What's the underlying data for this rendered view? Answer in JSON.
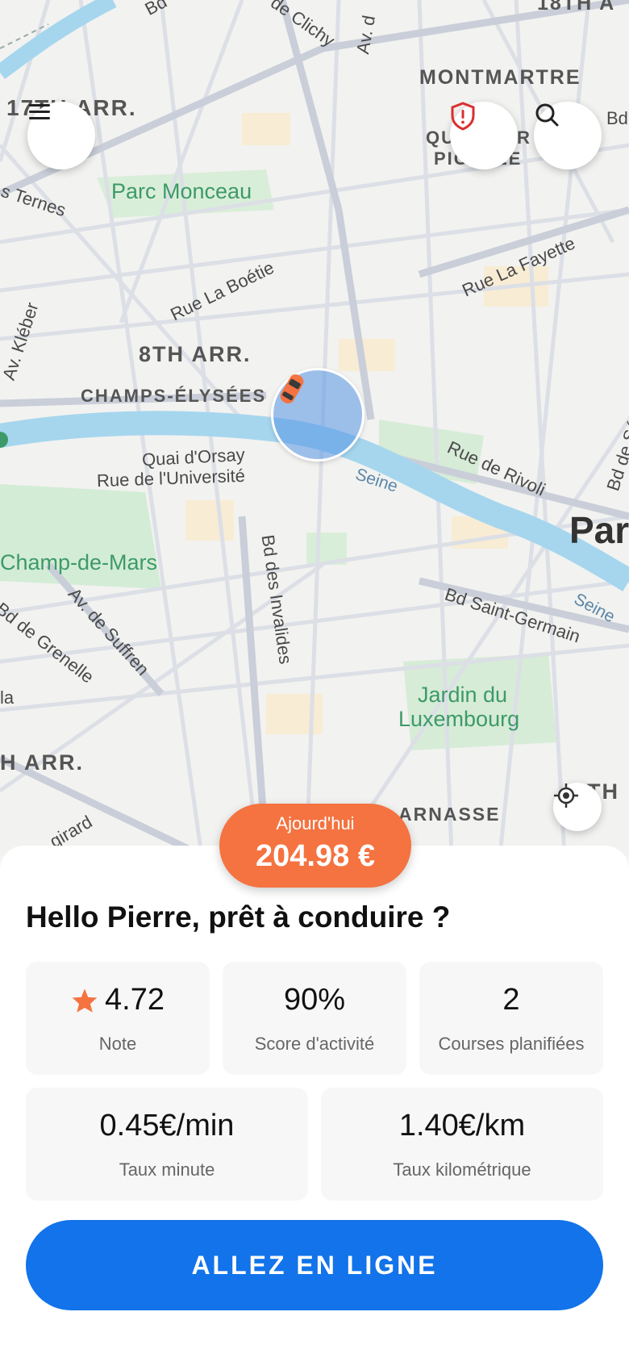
{
  "map": {
    "labels": {
      "bd_top": "Bd",
      "clichy": "de Clichy",
      "av_top": "Av. d",
      "arr18": "18TH A",
      "montmartre": "MONTMARTRE",
      "arr17": "17TH ARR.",
      "quartier": "QUARTIER",
      "pigalle": "PIGALLE",
      "bd_right": "Bd",
      "ternes": "s Ternes",
      "parc_monceau": "Parc Monceau",
      "boetie": "Rue La Boétie",
      "lafayette": "Rue La Fayette",
      "kleber": "Av. Kléber",
      "arr8": "8TH ARR.",
      "champs": "CHAMPS-ÉLYSÉES",
      "quai_orsay": "Quai d'Orsay",
      "universite": "Rue de l'Université",
      "seine1": "Seine",
      "rivoli": "Rue de Rivoli",
      "bd_seba": "Bd de Séba",
      "paris": "Par",
      "champ_mars": "Champ-de-Mars",
      "invalides": "Bd des Invalides",
      "suffren": "Av. de Suffren",
      "grenelle": "Bd de Grenelle",
      "saint_germain": "Bd Saint-Germain",
      "seine2": "Seine",
      "la": "la",
      "jardin1": "Jardin du",
      "jardin2": "Luxembourg",
      "arr7": "H ARR.",
      "vaugirard": "girard",
      "parnasse": "ARNASSE",
      "th": "TH"
    },
    "icons": {
      "menu": "menu-icon",
      "shield": "shield-alert-icon",
      "search": "search-icon",
      "locate": "locate-icon",
      "car": "car-icon"
    }
  },
  "earnings": {
    "label": "Ajourd'hui",
    "amount": "204.98 €"
  },
  "greeting": "Hello Pierre, prêt à conduire ?",
  "stats": [
    {
      "value": "4.72",
      "caption": "Note",
      "icon": "star-icon"
    },
    {
      "value": "90%",
      "caption": "Score d'activité"
    },
    {
      "value": "2",
      "caption": "Courses planifiées"
    }
  ],
  "rates": [
    {
      "value": "0.45€/min",
      "caption": "Taux minute"
    },
    {
      "value": "1.40€/km",
      "caption": "Taux kilométrique"
    }
  ],
  "cta": {
    "label": "ALLEZ EN LIGNE"
  },
  "colors": {
    "accent_orange": "#f47340",
    "primary_blue": "#1273ea",
    "river": "#9dd3ec",
    "park": "#c8ead1",
    "shield_red": "#d93030"
  }
}
